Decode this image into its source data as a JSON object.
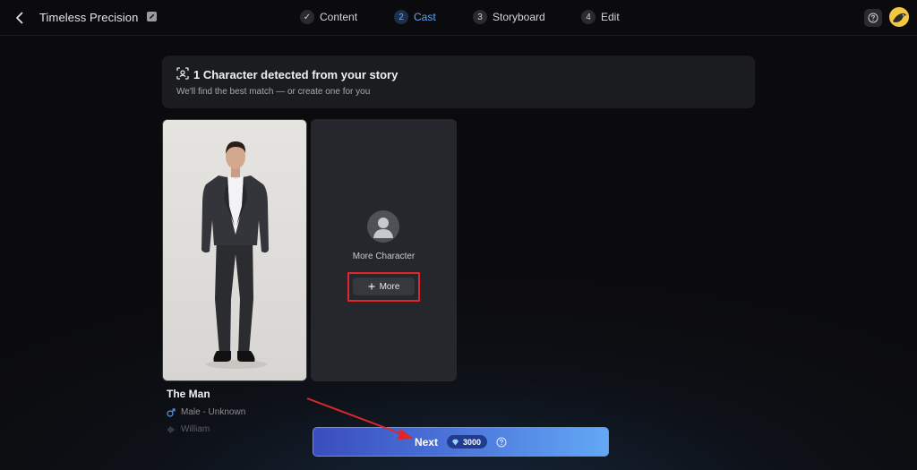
{
  "header": {
    "project_title": "Timeless Precision",
    "steps": [
      {
        "number": "✓",
        "label": "Content",
        "state": "done"
      },
      {
        "number": "2",
        "label": "Cast",
        "state": "active"
      },
      {
        "number": "3",
        "label": "Storyboard",
        "state": "pending"
      },
      {
        "number": "4",
        "label": "Edit",
        "state": "pending"
      }
    ],
    "help_icon": "question-circle-icon",
    "active_color": "#5ea4ff"
  },
  "banner": {
    "title": "1 Character detected from your story",
    "subtitle": "We'll find the best match — or create one for you",
    "icon": "scan-face-icon"
  },
  "character": {
    "name": "The Man",
    "gender_age": "Male - Unknown",
    "voice": "William",
    "gender_icon": "male-icon",
    "voice_icon": "voice-wave-icon"
  },
  "more_card": {
    "label": "More Character",
    "button_label": "More",
    "highlight_color": "#e0262a"
  },
  "footer": {
    "next_label": "Next",
    "credits": "3000",
    "credit_icon": "gem-icon"
  }
}
